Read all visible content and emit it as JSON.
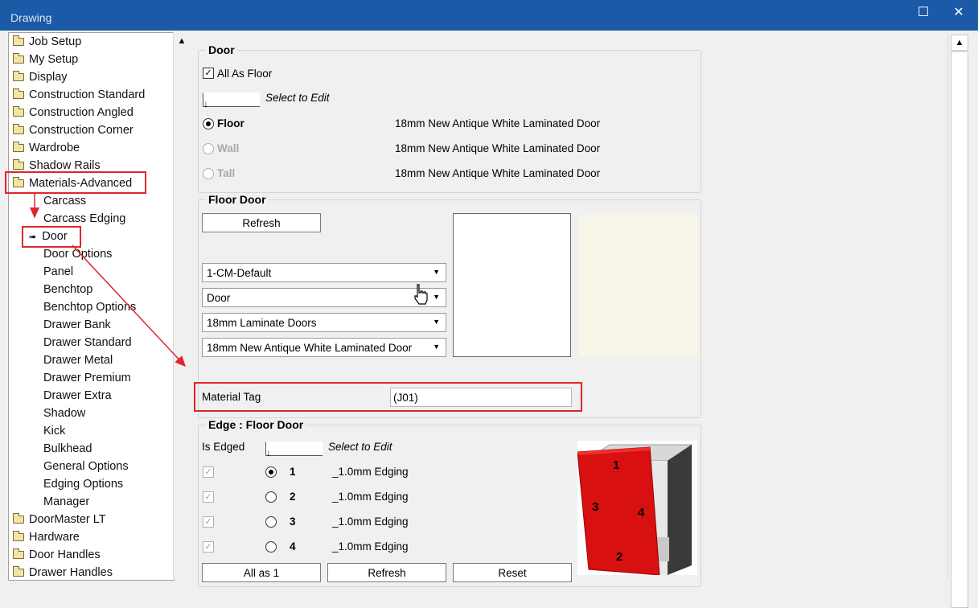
{
  "window": {
    "title": "Drawing",
    "maximize_icon": "maximize-icon",
    "close_icon": "close-icon"
  },
  "tree": {
    "top_items": [
      "Job Setup",
      "My Setup",
      "Display",
      "Construction Standard",
      "Construction Angled",
      "Construction Corner",
      "Wardrobe",
      "Shadow Rails"
    ],
    "selected_folder": "Materials-Advanced",
    "children": [
      "Carcass",
      "Carcass Edging",
      "Door",
      "Door Options",
      "Panel",
      "Benchtop",
      "Benchtop Options",
      "Drawer Bank",
      "Drawer Standard",
      "Drawer Metal",
      "Drawer Premium",
      "Drawer Extra",
      "Shadow",
      "Kick",
      "Bulkhead",
      "General Options",
      "Edging Options",
      "Manager"
    ],
    "bottom_items": [
      "DoorMaster LT",
      "Hardware",
      "Door Handles",
      "Drawer Handles"
    ]
  },
  "door_group": {
    "title": "Door",
    "all_as_floor": {
      "label": "All As Floor",
      "checked": true
    },
    "select_to_edit": "Select to Edit",
    "rows": [
      {
        "label": "Floor",
        "value": "18mm New Antique White Laminated Door",
        "selected": true,
        "enabled": true
      },
      {
        "label": "Wall",
        "value": "18mm New Antique White Laminated Door",
        "selected": false,
        "enabled": false
      },
      {
        "label": "Tall",
        "value": "18mm New Antique White Laminated Door",
        "selected": false,
        "enabled": false
      }
    ]
  },
  "floor_door_group": {
    "title": "Floor Door",
    "refresh_label": "Refresh",
    "combos": [
      "1-CM-Default",
      "Door",
      "18mm Laminate Doors",
      "18mm New Antique White Laminated Door"
    ],
    "material_tag_label": "Material Tag",
    "material_tag_value": "(J01)"
  },
  "edge_group": {
    "title": "Edge : Floor Door",
    "is_edged_label": "Is Edged",
    "select_to_edit": "Select to Edit",
    "edges": [
      {
        "num": "1",
        "value": "_1.0mm Edging",
        "selected": true
      },
      {
        "num": "2",
        "value": "_1.0mm Edging",
        "selected": false
      },
      {
        "num": "3",
        "value": "_1.0mm Edging",
        "selected": false
      },
      {
        "num": "4",
        "value": "_1.0mm Edging",
        "selected": false
      }
    ],
    "buttons": [
      "All as 1",
      "Refresh",
      "Reset"
    ],
    "preview_labels": [
      "1",
      "2",
      "3",
      "4"
    ]
  },
  "colors": {
    "titlebar": "#1a5aa6",
    "annotation": "#e0262a",
    "door_red": "#d81010"
  }
}
